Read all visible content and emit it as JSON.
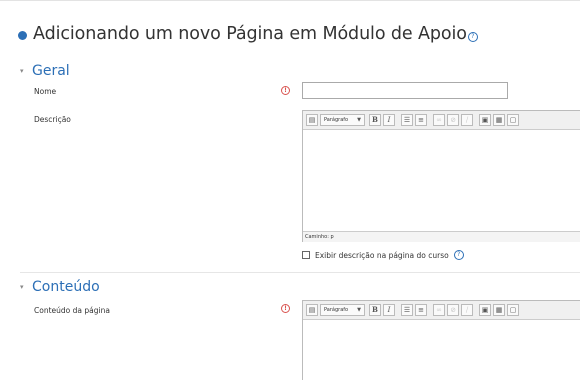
{
  "page": {
    "title": "Adicionando um novo Página em Módulo de Apoio",
    "title_help_glyph": "?"
  },
  "sections": {
    "general": {
      "title": "Geral",
      "caret": "▾"
    },
    "content": {
      "title": "Conteúdo",
      "caret": "▾"
    }
  },
  "fields": {
    "name": {
      "label": "Nome",
      "required_glyph": "!",
      "value": ""
    },
    "description": {
      "label": "Descrição"
    },
    "page_content": {
      "label": "Conteúdo da página",
      "required_glyph": "!"
    }
  },
  "editor": {
    "format_select": "Parágrafo",
    "bold": "B",
    "italic": "I",
    "path_label": "Caminho: p"
  },
  "checkbox": {
    "label": "Exibir descrição na página do curso",
    "checked": false,
    "help_glyph": "?"
  },
  "colors": {
    "accent": "#2c6fb6",
    "required": "#d9534f"
  }
}
